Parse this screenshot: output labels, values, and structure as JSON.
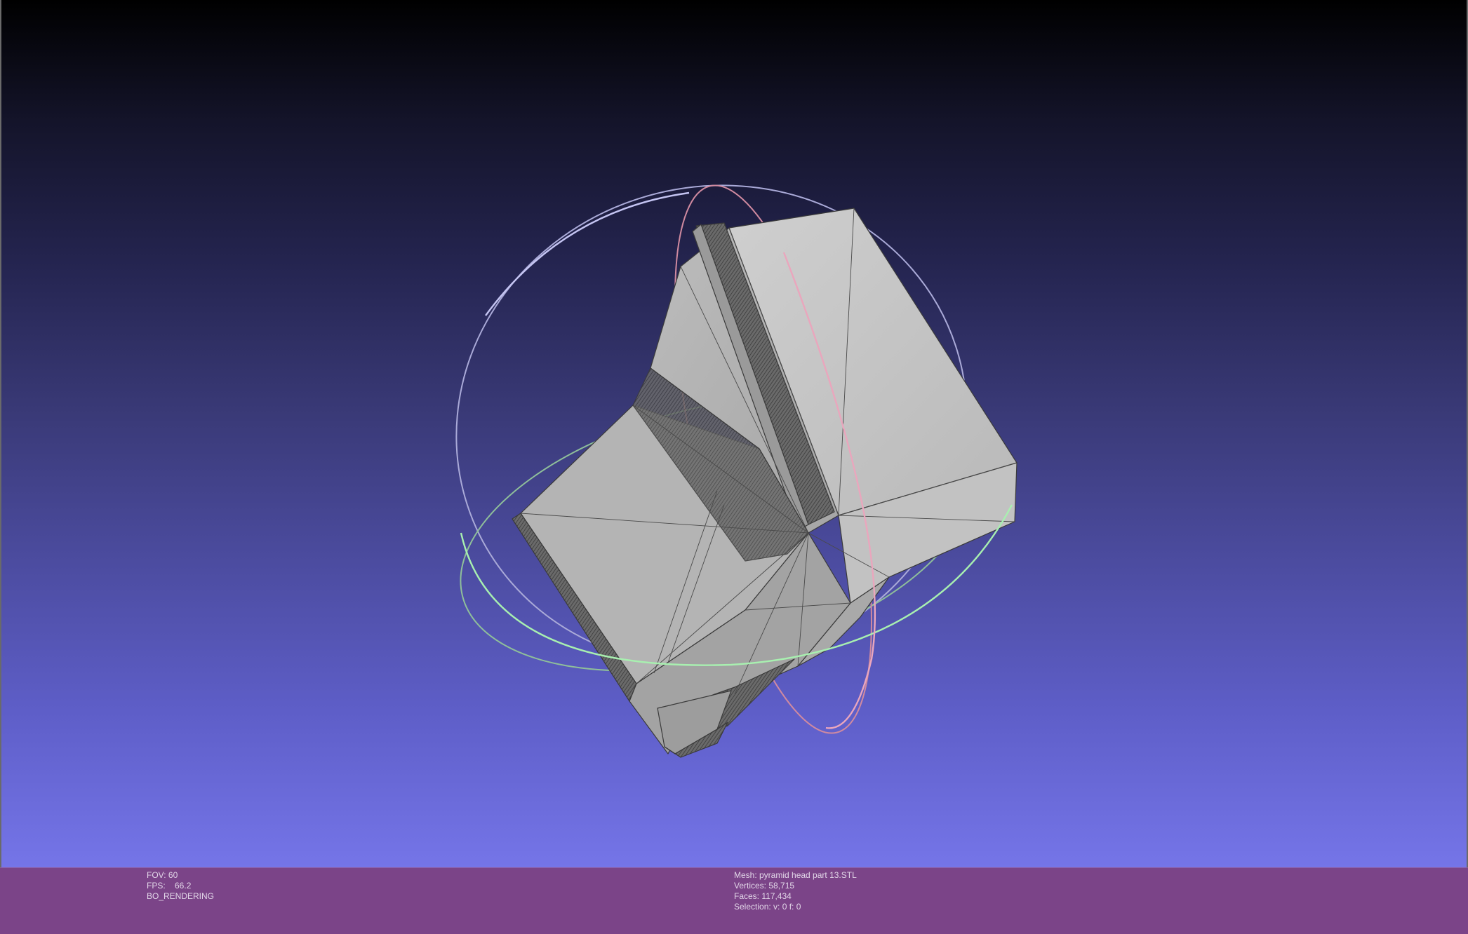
{
  "render_info": {
    "fov": "FOV: 60",
    "fps": "FPS:    66.2",
    "render_mode": "BO_RENDERING"
  },
  "mesh_info": {
    "mesh": "Mesh: pyramid head part 13.STL",
    "vertices": "Vertices: 58,715",
    "faces": "Faces: 117,434",
    "selection": "Selection: v: 0 f: 0"
  },
  "colors": {
    "background_top": "#000000",
    "background_bottom": "#7575e8",
    "info_bar": "#7b4488",
    "mesh_fill": "#bdbdbd",
    "trackball_red": "#e8a0b8",
    "trackball_green": "#a8f0b0",
    "trackball_blue": "#b8b8f0"
  }
}
